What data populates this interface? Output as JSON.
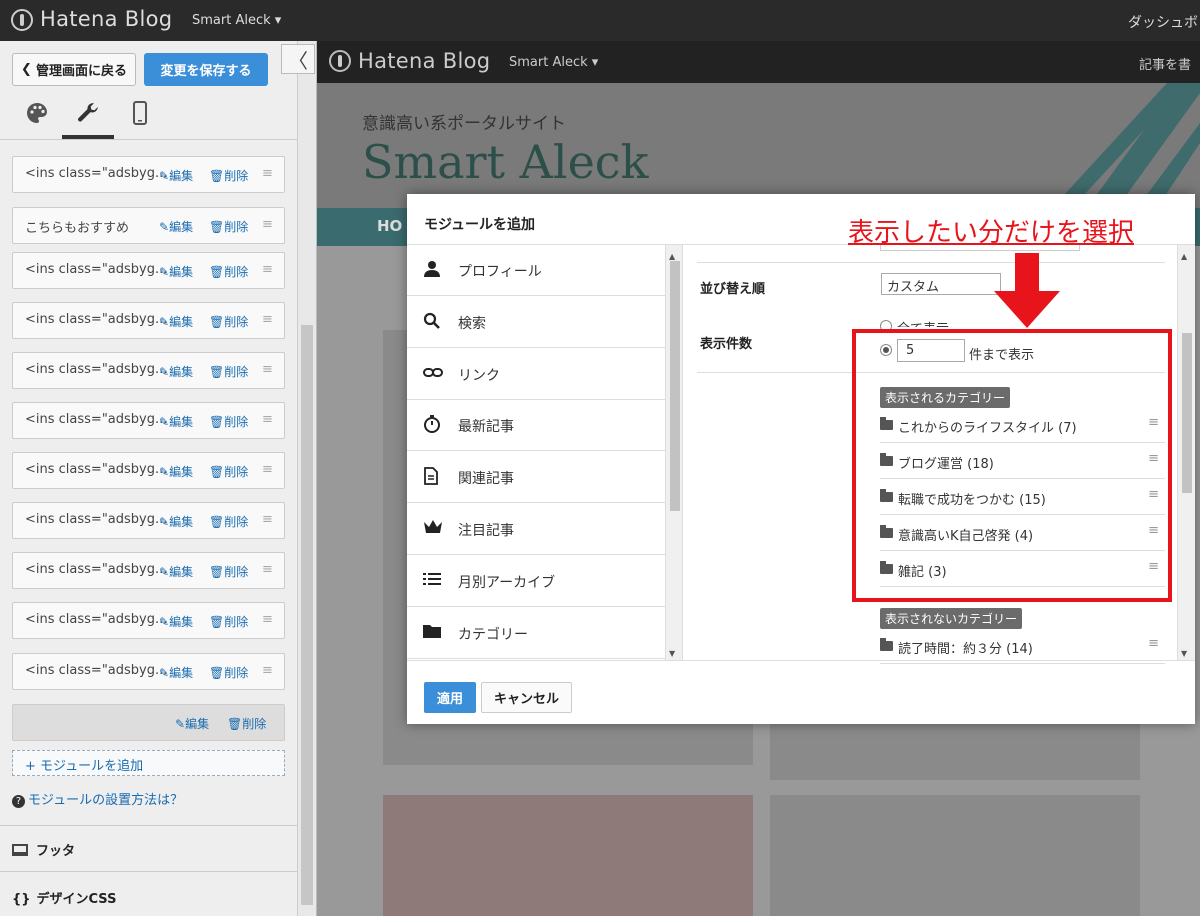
{
  "topbar": {
    "logo": "Hatena Blog",
    "blog": "Smart Aleck ▾",
    "right": "ダッシュボ"
  },
  "sidebar": {
    "back": "管理画面に戻る",
    "save": "変更を保存する",
    "collapse": "〈",
    "tabs": [
      "palette-icon",
      "wrench-icon",
      "phone-icon"
    ],
    "modules": [
      {
        "name": "<ins class=\"adsbyg...",
        "edit": "編集",
        "del": "削除"
      },
      {
        "name": "こちらもおすすめ",
        "edit": "編集",
        "del": "削除"
      },
      {
        "name": "<ins class=\"adsbyg...",
        "edit": "編集",
        "del": "削除"
      },
      {
        "name": "<ins class=\"adsbyg...",
        "edit": "編集",
        "del": "削除"
      },
      {
        "name": "<ins class=\"adsbyg...",
        "edit": "編集",
        "del": "削除"
      },
      {
        "name": "<ins class=\"adsbyg...",
        "edit": "編集",
        "del": "削除"
      },
      {
        "name": "<ins class=\"adsbyg...",
        "edit": "編集",
        "del": "削除"
      },
      {
        "name": "<ins class=\"adsbyg...",
        "edit": "編集",
        "del": "削除"
      },
      {
        "name": "<ins class=\"adsbyg...",
        "edit": "編集",
        "del": "削除"
      },
      {
        "name": "<ins class=\"adsbyg...",
        "edit": "編集",
        "del": "削除"
      },
      {
        "name": "<ins class=\"adsbyg...",
        "edit": "編集",
        "del": "削除"
      },
      {
        "name": "",
        "edit": "編集",
        "del": "削除"
      }
    ],
    "add": "+ モジュールを追加",
    "help": "モジュールの設置方法は？",
    "footer": "フッタ",
    "css": "デザインCSS"
  },
  "preview": {
    "logo": "Hatena Blog",
    "blog": "Smart Aleck ▾",
    "right": "記事を書",
    "tagline": "意識高い系ポータルサイト",
    "title": "Smart Aleck",
    "nav": "HO"
  },
  "modal": {
    "title": "モジュールを追加",
    "list": [
      "プロフィール",
      "検索",
      "リンク",
      "最新記事",
      "関連記事",
      "注目記事",
      "月別アーカイブ",
      "カテゴリー"
    ],
    "sort_label": "並び替え順",
    "sort_value": "カスタム",
    "count_label": "表示件数",
    "opt_all": "全て表示",
    "count_value": "5",
    "count_suffix": "件まで表示",
    "shown_tag": "表示されるカテゴリー",
    "shown": [
      "これからのライフスタイル (7)",
      "ブログ運営 (18)",
      "転職で成功をつかむ (15)",
      "意識高いK自己啓発 (4)",
      "雑記 (3)"
    ],
    "hidden_tag": "表示されないカテゴリー",
    "hidden": [
      "読了時間：約３分 (14)"
    ],
    "apply": "適用",
    "cancel": "キャンセル"
  },
  "annotation": {
    "text": "表示したい分だけを選択",
    "color": "#e8141c"
  },
  "colors": {
    "accent": "#3b8fd8",
    "nav": "#3a6b6e"
  }
}
